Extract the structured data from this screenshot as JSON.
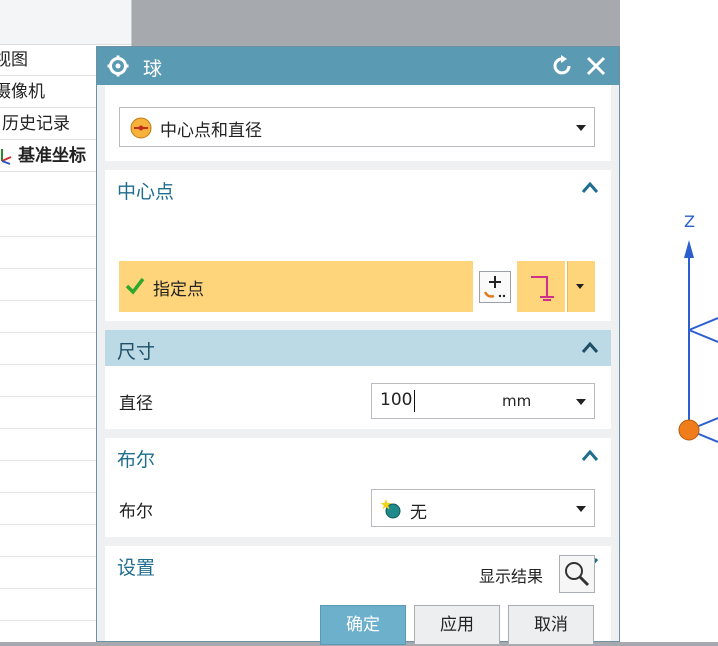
{
  "navigator": {
    "items": [
      {
        "label": "视图"
      },
      {
        "label": "摄像机"
      },
      {
        "label": "历史记录"
      },
      {
        "label": "基准坐标"
      }
    ]
  },
  "viewport": {
    "axis_label": "Z"
  },
  "dialog": {
    "title": "球",
    "type_selector": {
      "value": "中心点和直径"
    },
    "sections": {
      "center": {
        "title": "中心点",
        "point_label": "指定点"
      },
      "dimension": {
        "title": "尺寸",
        "diameter_label": "直径",
        "diameter_value": "100",
        "unit": "mm"
      },
      "boolean": {
        "title": "布尔",
        "field_label": "布尔",
        "value": "无"
      },
      "settings": {
        "title": "设置"
      }
    },
    "show_result_label": "显示结果",
    "buttons": {
      "ok": "确定",
      "apply": "应用",
      "cancel": "取消"
    },
    "colors": {
      "titlebar": "#5b9ab3",
      "highlight": "#ffd57b",
      "section_active": "#bcd9e6",
      "accent_text": "#1f6d8f"
    }
  }
}
